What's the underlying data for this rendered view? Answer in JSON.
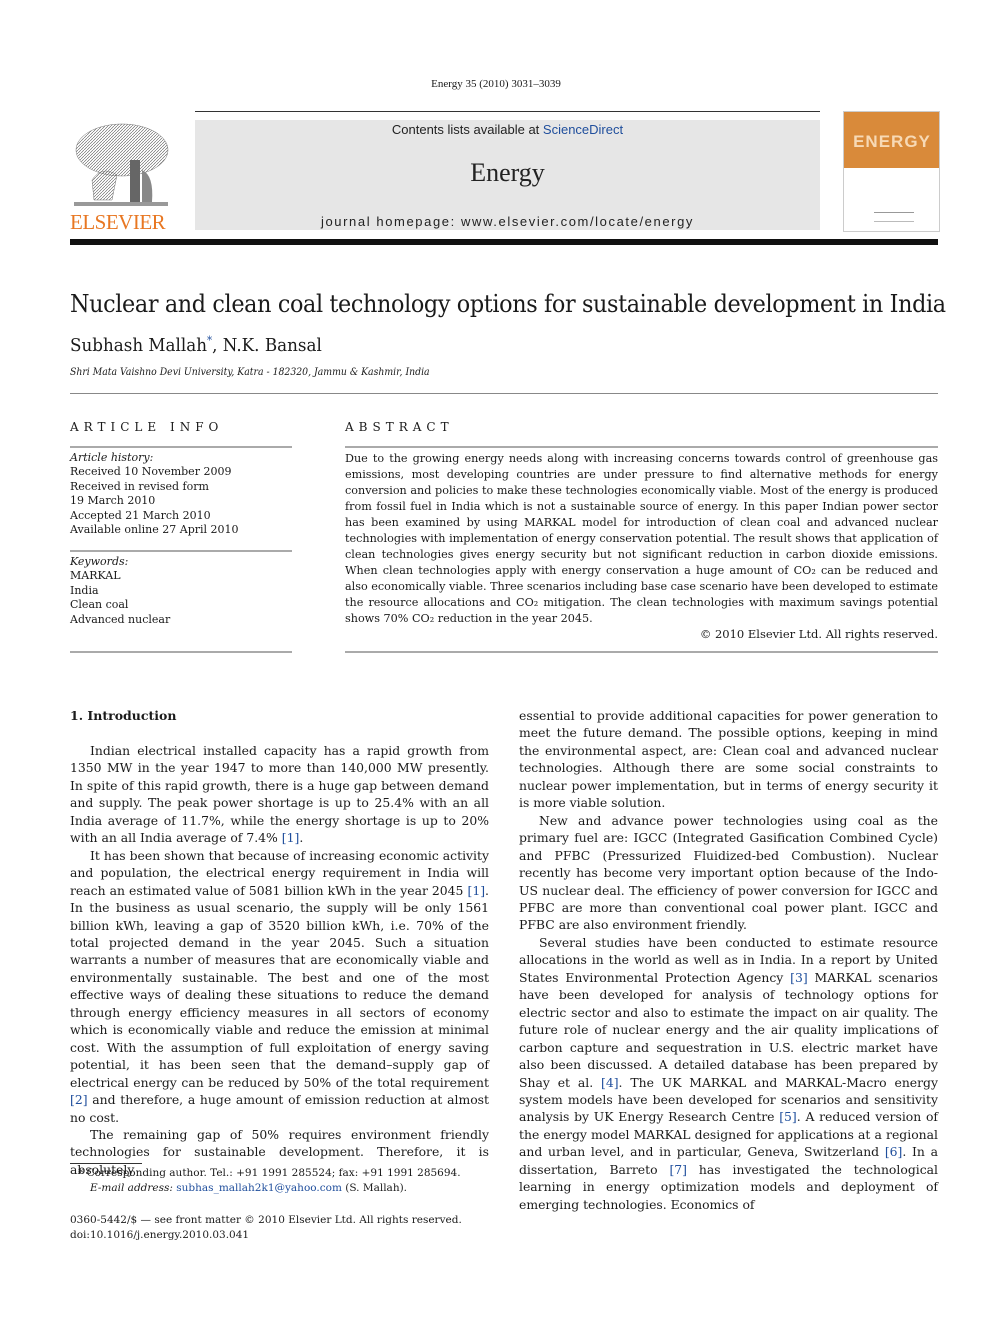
{
  "running_head": "Energy 35 (2010) 3031–3039",
  "masthead": {
    "publisher": "ELSEVIER",
    "contents_prefix": "Contents lists available at ",
    "contents_link": "ScienceDirect",
    "journal_name": "Energy",
    "homepage": "journal homepage: www.elsevier.com/locate/energy",
    "cover_title": "ENERGY",
    "brand_color": "#e87722"
  },
  "article": {
    "title": "Nuclear and clean coal technology options for sustainable development in India",
    "authors": "Subhash Mallah",
    "author_marker": "*",
    "coauthors": ", N.K. Bansal",
    "affiliation": "Shri Mata Vaishno Devi University, Katra - 182320, Jammu & Kashmir, India"
  },
  "article_info": {
    "heading": "ARTICLE INFO",
    "history_label": "Article history:",
    "history": [
      "Received 10 November 2009",
      "Received in revised form",
      "19 March 2010",
      "Accepted 21 March 2010",
      "Available online 27 April 2010"
    ],
    "keywords_label": "Keywords:",
    "keywords": [
      "MARKAL",
      "India",
      "Clean coal",
      "Advanced nuclear"
    ]
  },
  "abstract": {
    "heading": "ABSTRACT",
    "p1": "Due to the growing energy needs along with increasing concerns towards control of greenhouse gas emissions, most developing countries are under pressure to find alternative methods for energy conversion and policies to make these technologies economically viable. Most of the energy is produced from fossil fuel in India which is not a sustainable source of energy. In this paper Indian power sector has been examined by using MARKAL model for introduction of clean coal and advanced nuclear technologies with implementation of energy conservation potential. The result shows that application of clean technologies gives energy security but not significant reduction in carbon dioxide emissions. When clean technologies apply with energy conservation a huge amount of ",
    "co2_a": "CO₂",
    "p2": " can be reduced and also economically viable. Three scenarios including base case scenario have been developed to estimate the resource allocations and ",
    "co2_b": "CO₂",
    "p3": " mitigation. The clean technologies with maximum savings potential shows 70% ",
    "co2_c": "CO₂",
    "p4": " reduction in the year 2045.",
    "copyright": "© 2010 Elsevier Ltd. All rights reserved."
  },
  "intro": {
    "heading": "1.  Introduction",
    "left": {
      "p1a": "Indian electrical installed capacity has a rapid growth from 1350 MW in the year 1947 to more than 140,000 MW presently. In spite of this rapid growth, there is a huge gap between demand and supply. The peak power shortage is up to 25.4% with an all India average of 11.7%, while the energy shortage is up to 20% with an all India average of 7.4% ",
      "ref1": "[1]",
      "p1b": ".",
      "p2a": "It has been shown that because of increasing economic activity and population, the electrical energy requirement in India will reach an estimated value of 5081 billion kWh in the year 2045 ",
      "ref2": "[1]",
      "p2b": ". In the business as usual scenario, the supply will be only 1561 billion kWh, leaving a gap of 3520 billion kWh, i.e. 70% of the total projected demand in the year 2045. Such a situation warrants a number of measures that are economically viable and environmentally sustainable. The best and one of the most effective ways of dealing these situations to reduce the demand through energy efficiency measures in all sectors of economy which is economically viable and reduce the emission at minimal cost. With the assumption of full exploitation of energy saving potential, it has been seen that the demand–supply gap of electrical energy can be reduced by 50% of the total requirement ",
      "ref3": "[2]",
      "p2c": " and therefore, a huge amount of emission reduction at almost no cost.",
      "p3": "The remaining gap of 50% requires environment friendly technologies for sustainable development. Therefore, it is absolutely"
    },
    "right": {
      "p1": "essential to provide additional capacities for power generation to meet the future demand. The possible options, keeping in mind the environmental aspect, are: Clean coal and advanced nuclear technologies. Although there are some social constraints to nuclear power implementation, but in terms of energy security it is more viable solution.",
      "p2": "New and advance power technologies using coal as the primary fuel are: IGCC (Integrated Gasification Combined Cycle) and PFBC (Pressurized Fluidized-bed Combustion). Nuclear recently has become very important option because of the Indo-US nuclear deal. The efficiency of power conversion for IGCC and PFBC are more than conventional coal power plant. IGCC and PFBC are also environment friendly.",
      "p3a": "Several studies have been conducted to estimate resource allocations in the world as well as in India. In a report by United States Environmental Protection Agency ",
      "ref3": "[3]",
      "p3b": " MARKAL scenarios have been developed for analysis of technology options for electric sector and also to estimate the impact on air quality. The future role of nuclear energy and the air quality implications of carbon capture and sequestration in U.S. electric market have also been discussed. A detailed database has been prepared by Shay et al. ",
      "ref4": "[4]",
      "p3c": ". The UK MARKAL and MARKAL-Macro energy system models have been developed for scenarios and sensitivity analysis by UK Energy Research Centre ",
      "ref5": "[5]",
      "p3d": ". A reduced version of the energy model MARKAL designed for applications at a regional and urban level, and in particular, Geneva, Switzerland ",
      "ref6": "[6]",
      "p3e": ". In a dissertation, Barreto ",
      "ref7": "[7]",
      "p3f": " has investigated the technological learning in energy optimization models and deployment of emerging technologies. Economics of"
    }
  },
  "footnote": {
    "marker": "*",
    "corresponding": " Corresponding author. Tel.: +91 1991 285524; fax: +91 1991 285694.",
    "email_label": "E-mail address: ",
    "email": "subhas_mallah2k1@yahoo.com",
    "email_suffix": " (S. Mallah)."
  },
  "front_matter": {
    "issn": "0360-5442/$ — see front matter © 2010 Elsevier Ltd. All rights reserved.",
    "doi": "doi:10.1016/j.energy.2010.03.041"
  }
}
